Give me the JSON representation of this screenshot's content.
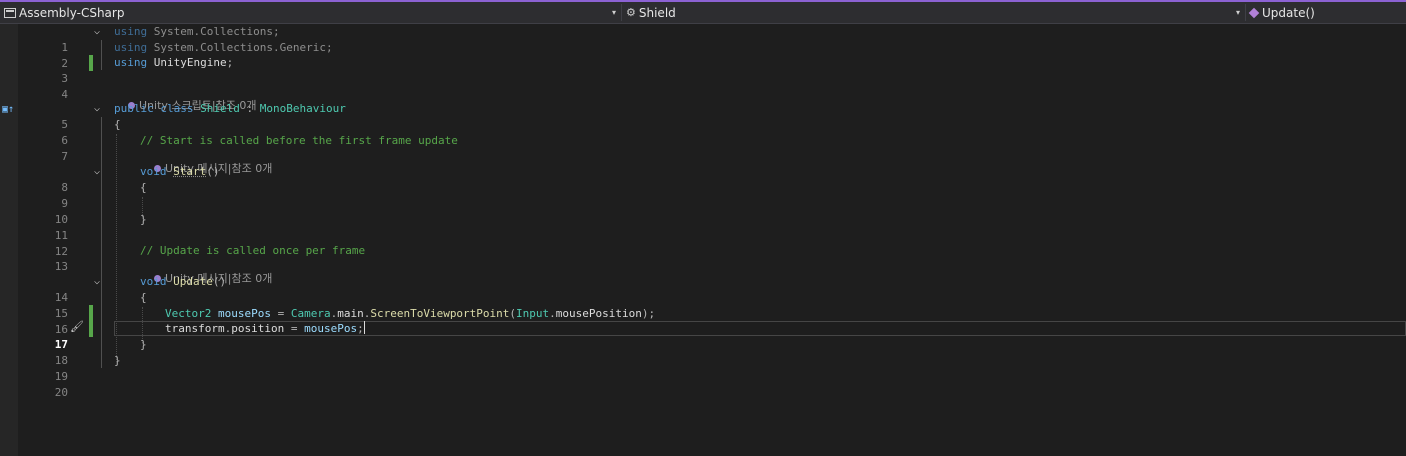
{
  "navbar": {
    "project": "Assembly-CSharp",
    "type_name": "Shield",
    "member": "Update()",
    "dropdown_glyph": "▾",
    "project_icon": "csharp-project-icon",
    "type_icon": "class-icon",
    "member_icon": "method-icon"
  },
  "editor": {
    "current_line": "17",
    "codelens": {
      "class_ref": "Unity 스크립트|참조 0개",
      "start_ref": "Unity 메시지|참조 0개",
      "update_ref": "Unity 메시지|참조 0개"
    },
    "line_numbers": [
      "1",
      "2",
      "3",
      "4",
      "5",
      "6",
      "7",
      "8",
      "9",
      "10",
      "11",
      "12",
      "13",
      "14",
      "15",
      "16",
      "17",
      "18",
      "19",
      "20"
    ],
    "code": {
      "l1": {
        "kw": "using",
        "ns": "System.Collections",
        "end": ";"
      },
      "l2": {
        "kw": "using",
        "ns": "System.Collections.Generic",
        "end": ";"
      },
      "l3": {
        "kw": "using",
        "ns": "UnityEngine",
        "end": ";"
      },
      "l5": {
        "kw1": "public",
        "kw2": "class",
        "name": "Shield",
        "colon": " : ",
        "base": "MonoBehaviour"
      },
      "l6": "{",
      "l7": "// Start is called before the first frame update",
      "l8": {
        "kw": "void",
        "name": "Start",
        "parens": "()"
      },
      "l9": "{",
      "l11": "}",
      "l13": "// Update is called once per frame",
      "l14": {
        "kw": "void",
        "name": "Update",
        "parens": "()"
      },
      "l15": "{",
      "l16": {
        "type": "Vector2",
        "var": "mousePos",
        "eq": " = ",
        "cls": "Camera",
        "dot1": ".",
        "prop": "main",
        "dot2": ".",
        "method": "ScreenToViewportPoint",
        "open": "(",
        "arg_cls": "Input",
        "dot3": ".",
        "arg_prop": "mousePosition",
        "close": ");"
      },
      "l17": {
        "obj": "transform",
        "dot": ".",
        "prop": "position",
        "eq": " = ",
        "var": "mousePos",
        "end": ";"
      },
      "l18": "}",
      "l19": "}"
    }
  },
  "colors": {
    "accent": "#8c62d3",
    "keyword": "#569cd6",
    "type": "#4ec9b0",
    "comment": "#57a64a",
    "method": "#dcdcaa",
    "change_marker": "#57a64a"
  }
}
